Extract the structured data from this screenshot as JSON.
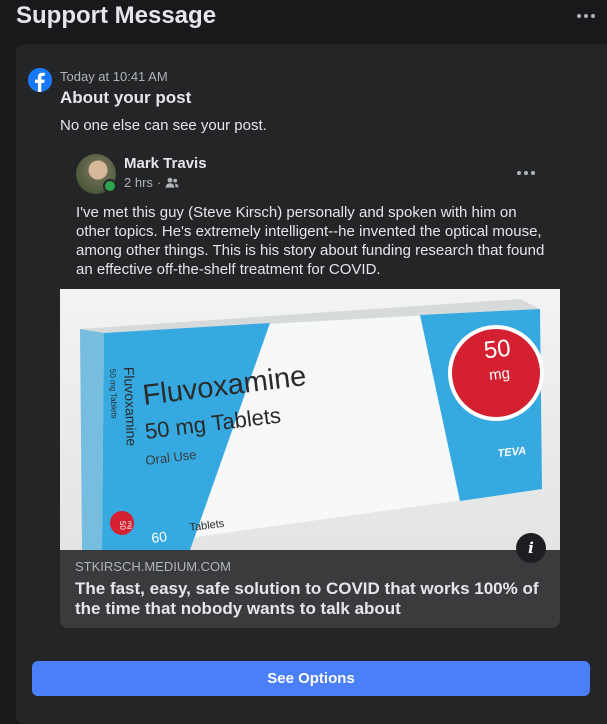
{
  "header": {
    "title": "Support Message",
    "more_icon": "more-horizontal-icon"
  },
  "message": {
    "source_icon": "facebook-icon",
    "timestamp": "Today at 10:41 AM",
    "title": "About your post",
    "notice": "No one else can see your post."
  },
  "post": {
    "author": "Mark Travis",
    "time": "2 hrs",
    "separator": "·",
    "audience_icon": "friends-icon",
    "more_icon": "more-horizontal-icon",
    "text": "I've met this guy (Steve Kirsch) personally and spoken with him on other topics. He's extremely intelligent--he invented the optical mouse, among other things. This is his story about funding research that found an effective off-the-shelf treatment for COVID.",
    "link": {
      "image": {
        "product": "Fluvoxamine",
        "strength": "50 mg Tablets",
        "use": "Oral Use",
        "side_product": "Fluvoxamine",
        "side_strength": "50 mg Tablets",
        "badge_number": "50",
        "badge_unit": "mg",
        "count": "60",
        "count_label": "Tablets",
        "brand": "TEVA",
        "mini_badge_number": "50",
        "mini_badge_unit": "mg"
      },
      "info_icon": "info-icon",
      "info_glyph": "i",
      "domain": "STKIRSCH.MEDIUM.COM",
      "title": "The fast, easy, safe solution to COVID that works 100% of the time that nobody wants to talk about"
    }
  },
  "actions": {
    "see_options": "See Options"
  },
  "colors": {
    "background": "#18191a",
    "panel": "#242526",
    "card": "#3a3b3c",
    "primary_button": "#4b7ff8",
    "facebook_blue": "#1877f2",
    "online": "#31a24c",
    "pill_box_blue": "#35a9e0",
    "badge_red": "#d42030"
  }
}
